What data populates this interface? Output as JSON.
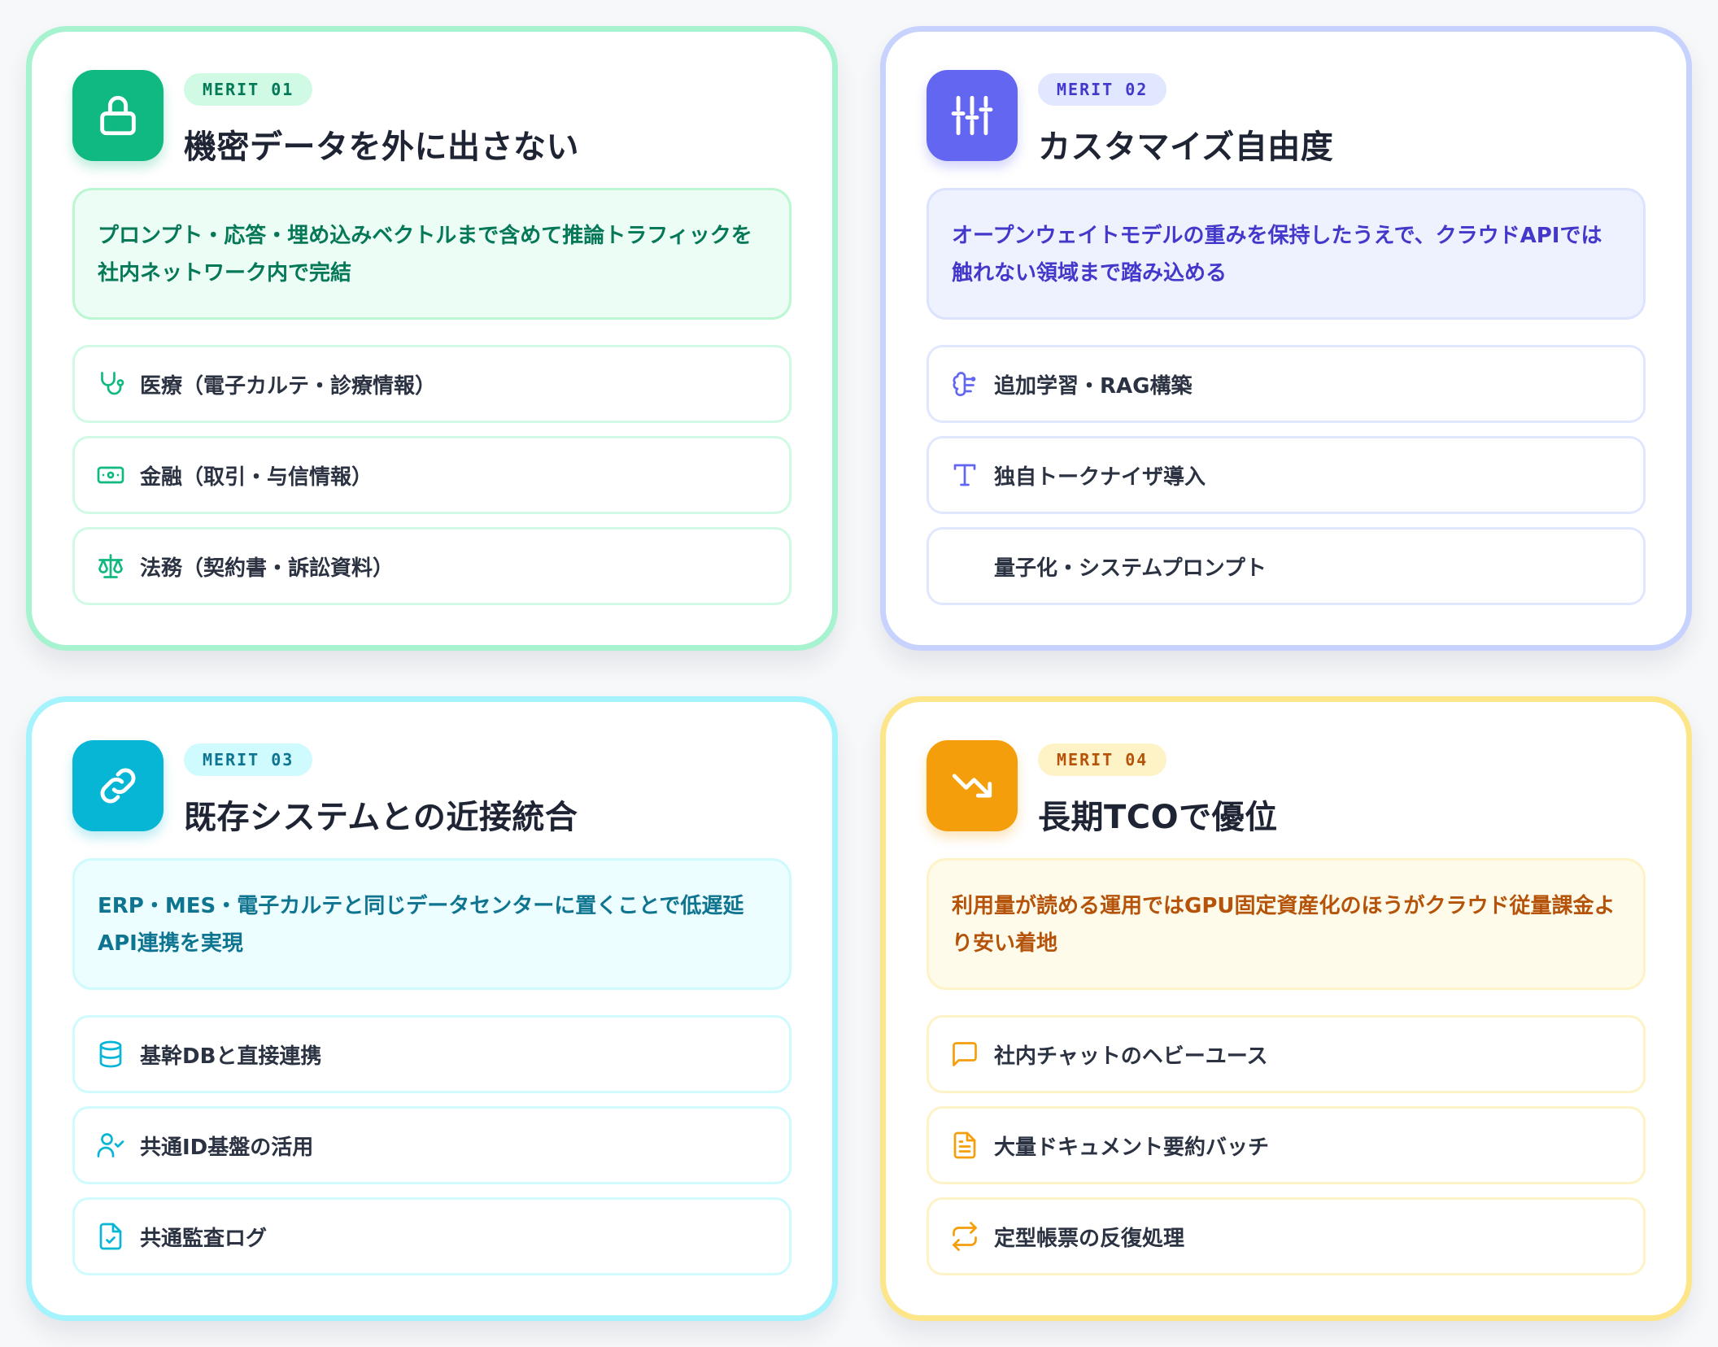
{
  "cards": [
    {
      "merit_label": "MERIT 01",
      "title": "機密データを外に出さない",
      "icon": "lock-icon",
      "description": "プロンプト・応答・埋め込みベクトルまで含めて推論トラフィックを社内ネットワーク内で完結",
      "colors": {
        "accent": "#10b981",
        "card_border": "#a7f3d0",
        "pill_bg": "#d1fae5",
        "pill_text": "#047857",
        "desc_bg": "#ecfdf5",
        "desc_border": "#bbf7d0",
        "desc_text": "#047857",
        "item_border": "#d1fae5"
      },
      "items": [
        {
          "icon": "stethoscope-icon",
          "label": "医療（電子カルテ・診療情報）"
        },
        {
          "icon": "banknote-icon",
          "label": "金融（取引・与信情報）"
        },
        {
          "icon": "scale-icon",
          "label": "法務（契約書・訴訟資料）"
        }
      ]
    },
    {
      "merit_label": "MERIT 02",
      "title": "カスタマイズ自由度",
      "icon": "sliders-icon",
      "description": "オープンウェイトモデルの重みを保持したうえで、クラウドAPIでは触れない領域まで踏み込める",
      "colors": {
        "accent": "#6366f1",
        "card_border": "#c7d2fe",
        "pill_bg": "#e0e7ff",
        "pill_text": "#4338ca",
        "desc_bg": "#eef2ff",
        "desc_border": "#dbe3fe",
        "desc_text": "#4338ca",
        "item_border": "#e0e7ff"
      },
      "items": [
        {
          "icon": "brain-icon",
          "label": "追加学習・RAG構築"
        },
        {
          "icon": "type-icon",
          "label": "独自トークナイザ導入"
        },
        {
          "icon": "",
          "label": "量子化・システムプロンプト"
        }
      ]
    },
    {
      "merit_label": "MERIT 03",
      "title": "既存システムとの近接統合",
      "icon": "link-icon",
      "description": "ERP・MES・電子カルテと同じデータセンターに置くことで低遅延API連携を実現",
      "colors": {
        "accent": "#06b6d4",
        "card_border": "#a5f3fc",
        "pill_bg": "#cffafe",
        "pill_text": "#0e7490",
        "desc_bg": "#ecfeff",
        "desc_border": "#cffafe",
        "desc_text": "#0e7490",
        "item_border": "#cffafe"
      },
      "items": [
        {
          "icon": "database-icon",
          "label": "基幹DBと直接連携"
        },
        {
          "icon": "user-check-icon",
          "label": "共通ID基盤の活用"
        },
        {
          "icon": "file-check-icon",
          "label": "共通監査ログ"
        }
      ]
    },
    {
      "merit_label": "MERIT 04",
      "title": "長期TCOで優位",
      "icon": "trending-down-icon",
      "description": "利用量が読める運用ではGPU固定資産化のほうがクラウド従量課金より安い着地",
      "colors": {
        "accent": "#f59e0b",
        "card_border": "#fde68a",
        "pill_bg": "#fef3c7",
        "pill_text": "#b45309",
        "desc_bg": "#fffbeb",
        "desc_border": "#fef3c7",
        "desc_text": "#b45309",
        "item_border": "#fef3c7"
      },
      "items": [
        {
          "icon": "chat-icon",
          "label": "社内チャットのヘビーユース"
        },
        {
          "icon": "document-icon",
          "label": "大量ドキュメント要約バッチ"
        },
        {
          "icon": "repeat-icon",
          "label": "定型帳票の反復処理"
        }
      ]
    }
  ]
}
